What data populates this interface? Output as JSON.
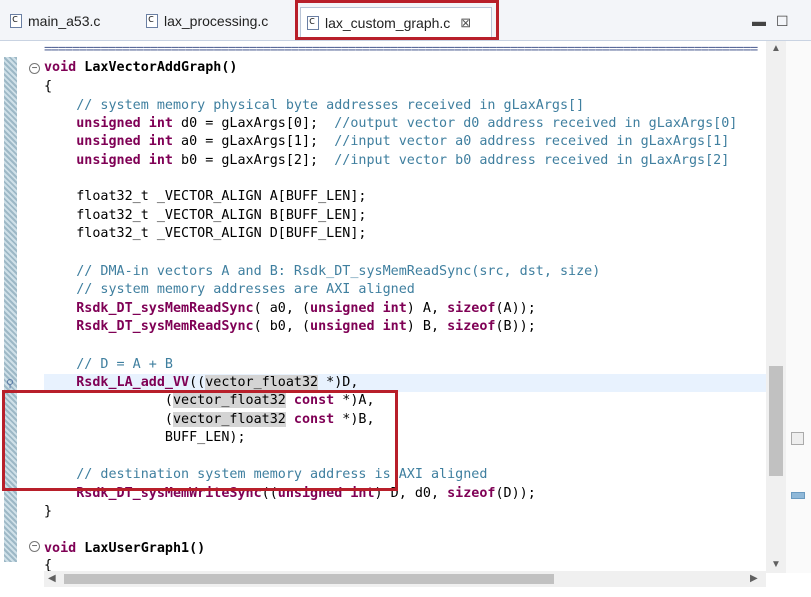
{
  "tabs": [
    {
      "label": "main_a53.c",
      "active": false
    },
    {
      "label": "lax_processing.c",
      "active": false
    },
    {
      "label": "lax_custom_graph.c",
      "active": true
    }
  ],
  "icons": {
    "file": "c-source-file-icon",
    "close": "close-icon",
    "minimize": "minimize-icon",
    "maximize": "maximize-icon",
    "fold_open": "fold-collapse-icon",
    "fold_closed": "fold-expand-icon"
  },
  "colors": {
    "keyword": "#7f0055",
    "comment": "#3f7f9f",
    "highlight_box": "#b81f2a",
    "current_line": "#e8f2fe"
  },
  "code": {
    "separator": "=====================================================================================================",
    "fn1_kw": "void",
    "fn1_name": " LaxVectorAddGraph()",
    "brace_open": "{",
    "c1": "    // system memory physical byte addresses received in gLaxArgs[]",
    "d0_kw": "    unsigned int",
    "d0_rest": " d0 = gLaxArgs[0];  ",
    "d0_cm": "//output vector d0 address received in gLaxArgs[0]",
    "a0_kw": "    unsigned int",
    "a0_rest": " a0 = gLaxArgs[1];  ",
    "a0_cm": "//input vector a0 address received in gLaxArgs[1]",
    "b0_kw": "    unsigned int",
    "b0_rest": " b0 = gLaxArgs[2];  ",
    "b0_cm": "//input vector b0 address received in gLaxArgs[2]",
    "decl_a": "    float32_t _VECTOR_ALIGN A[BUFF_LEN];",
    "decl_b": "    float32_t _VECTOR_ALIGN B[BUFF_LEN];",
    "decl_d": "    float32_t _VECTOR_ALIGN D[BUFF_LEN];",
    "c2": "    // DMA-in vectors A and B: Rsdk_DT_sysMemReadSync(src, dst, size)",
    "c3": "    // system memory addresses are AXI aligned",
    "rd1_fn": "    Rsdk_DT_sysMemReadSync",
    "rd1_a": "( a0, (",
    "rd1_kw": "unsigned int",
    "rd1_b": ") A, ",
    "rd1_kw2": "sizeof",
    "rd1_c": "(A));",
    "rd2_fn": "    Rsdk_DT_sysMemReadSync",
    "rd2_a": "( b0, (",
    "rd2_kw": "unsigned int",
    "rd2_b": ") B, ",
    "rd2_kw2": "sizeof",
    "rd2_c": "(B));",
    "c4": "    // D = A + B",
    "add_fn": "    Rsdk_LA_add_VV",
    "add_a": "((",
    "add_t": "vector_float32",
    "add_b": " *)D,",
    "arg2_a": "               (",
    "arg2_t": "vector_float32",
    "arg2_kw": " const",
    "arg2_b": " *)A,",
    "arg3_a": "               (",
    "arg3_t": "vector_float32",
    "arg3_kw": " const",
    "arg3_b": " *)B,",
    "arg4": "               BUFF_LEN);",
    "c5": "    // destination system memory address is AXI aligned",
    "wr_fn": "    Rsdk_DT_sysMemWriteSync",
    "wr_a": "((",
    "wr_kw": "unsigned int",
    "wr_b": ") D, d0, ",
    "wr_kw2": "sizeof",
    "wr_c": "(D));",
    "brace_close": "}",
    "fn2_kw": "void",
    "fn2_name": " LaxUserGraph1()",
    "brace_open2": "{"
  }
}
